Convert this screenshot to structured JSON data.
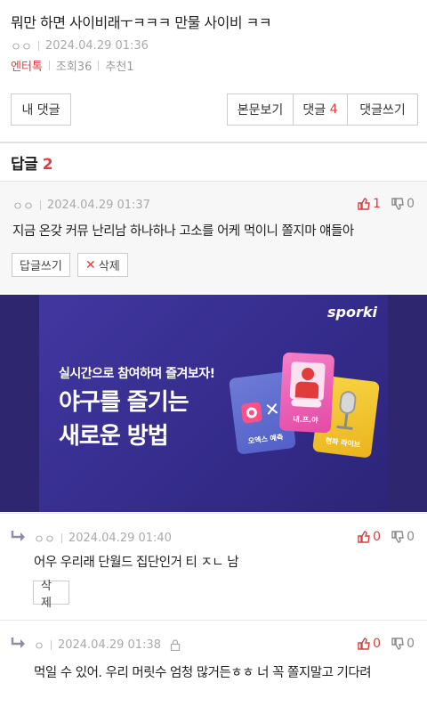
{
  "post": {
    "title": "뭐만 하면 사이비래ㅜㅋㅋㅋ 만물 사이비 ㅋㅋ",
    "author": "ㅇㅇ",
    "date": "2024.04.29 01:36",
    "category": "엔터톡",
    "views": "조회36",
    "recommends": "추천1"
  },
  "actions": {
    "my_comments": "내 댓글",
    "view_body": "본문보기",
    "comments_label": "댓글",
    "comments_count": "4",
    "write_comment": "댓글쓰기"
  },
  "replies_header": {
    "label": "답글",
    "count": "2"
  },
  "comments": [
    {
      "author": "ㅇㅇ",
      "date": "2024.04.29 01:37",
      "text": "지금 온갖 커뮤 난리남 하나하나 고소를 어케 먹이니 쫄지마 얘들아",
      "up": "1",
      "down": "0",
      "reply_label": "답글쓰기",
      "delete_label": "삭제"
    }
  ],
  "ad": {
    "brand": "sporki",
    "subtitle": "실시간으로 참여하며 즐겨보자!",
    "headline1": "야구를 즐기는",
    "headline2": "새로운 방법",
    "card_ox": "오엑스 예측",
    "card_me": "내.프.야",
    "card_live": "현파 라이브"
  },
  "replies": [
    {
      "author": "ㅇㅇ",
      "date": "2024.04.29 01:40",
      "text": "어우 우리래 단월드 집단인거 티 ㅈㄴ 남",
      "up": "0",
      "down": "0",
      "delete_label": "삭제"
    },
    {
      "author": "ㅇ",
      "date": "2024.04.29 01:38",
      "text": "먹일 수 있어. 우리 머릿수 엄청 많거든ㅎㅎ 너 꼭 쫄지말고 기다려",
      "up": "0",
      "down": "0"
    }
  ],
  "colors": {
    "accent": "#e23b3b",
    "ad_bg": "#2e2770"
  }
}
